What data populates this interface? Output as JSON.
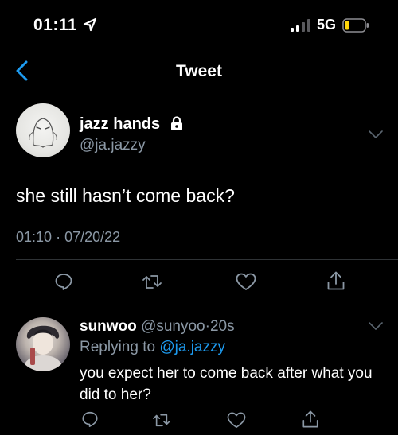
{
  "status_bar": {
    "time": "01:11",
    "network": "5G",
    "location_icon": "location-arrow-icon",
    "signal_icon": "cellular-signal-icon",
    "battery_icon": "battery-low-icon",
    "battery_color": "#ffd60a"
  },
  "nav": {
    "title": "Tweet",
    "back_icon": "chevron-left-icon",
    "accent_color": "#1d9bf0"
  },
  "tweet": {
    "author_name": "jazz hands",
    "author_handle": "@ja.jazzy",
    "lock_icon": "lock-icon",
    "text": "she still hasn’t come back?",
    "time": "01:10",
    "separator": "·",
    "date": "07/20/22",
    "actions": [
      "reply-icon",
      "retweet-icon",
      "like-icon",
      "share-icon"
    ]
  },
  "reply": {
    "author_name": "sunwoo",
    "author_handle": "@sunyoo",
    "separator": "·",
    "time_ago": "20s",
    "replying_prefix": "Replying to ",
    "replying_to": "@ja.jazzy",
    "text": "you expect her to come back after what you did to her?",
    "actions": [
      "reply-icon",
      "retweet-icon",
      "like-icon",
      "share-icon"
    ]
  }
}
